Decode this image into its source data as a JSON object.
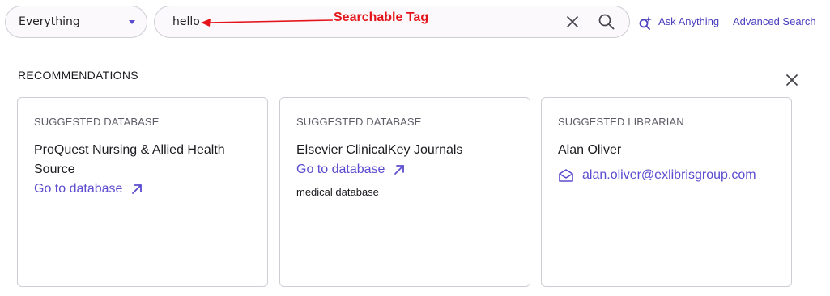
{
  "search": {
    "scope": "Everything",
    "query": "hello",
    "annotation": "Searchable Tag"
  },
  "links": {
    "ask_anything": "Ask Anything",
    "advanced_search": "Advanced Search"
  },
  "recommendations": {
    "heading": "RECOMMENDATIONS",
    "cards": [
      {
        "kind": "SUGGESTED DATABASE",
        "title": "ProQuest Nursing & Allied Health Source",
        "link": "Go to database"
      },
      {
        "kind": "SUGGESTED DATABASE",
        "title": "Elsevier ClinicalKey Journals",
        "link": "Go to database",
        "description": "medical database"
      },
      {
        "kind": "SUGGESTED LIBRARIAN",
        "title": "Alan Oliver",
        "email": "alan.oliver@exlibrisgroup.com"
      }
    ]
  },
  "icons": {
    "scope_caret": "chevron-down-icon",
    "clear": "close-icon",
    "search": "search-icon",
    "ask": "sparkle-search-icon",
    "close": "close-icon",
    "external": "arrow-up-right-icon",
    "mail": "envelope-icon"
  },
  "colors": {
    "accent": "#5b4ccf",
    "annotation": "#e3151a"
  }
}
